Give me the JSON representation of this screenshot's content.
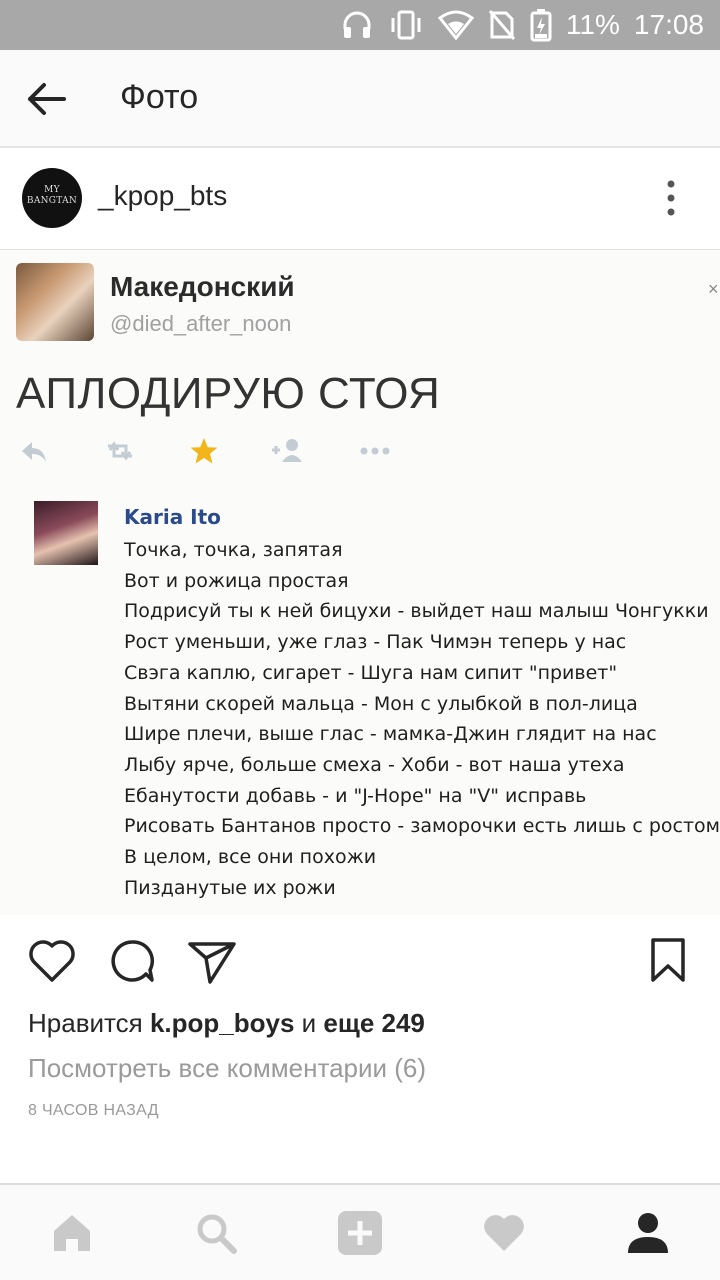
{
  "status_bar": {
    "battery": "11%",
    "time": "17:08",
    "icons": [
      "headphones-icon",
      "vibrate-icon",
      "wifi-icon",
      "no-sim-icon",
      "battery-icon"
    ]
  },
  "topbar": {
    "title": "Фото",
    "back_icon": "arrow-left-icon"
  },
  "post": {
    "username": "_kpop_bts",
    "avatar_text_line1": "MY",
    "avatar_text_line2": "BANGTAN",
    "more_icon": "more-vertical-icon"
  },
  "photo": {
    "tweet": {
      "name": "Македонский",
      "handle": "@died_after_noon",
      "close": "×",
      "text": "АПЛОДИРУЮ СТОЯ",
      "actions": [
        "reply-icon",
        "retweet-icon",
        "star-icon",
        "follow-icon",
        "more-horizontal-icon"
      ]
    },
    "inner_post": {
      "name": "Karia Ito",
      "lines": [
        "Точка, точка, запятая",
        "Вот и рожица простая",
        "Подрисуй ты к ней бицухи - выйдет наш малыш Чонгукки",
        "Рост уменьши, уже глаз - Пак Чимэн теперь у нас",
        "Свэга каплю, сигарет - Шуга нам сипит \"привет\"",
        "Вытяни скорей мальца - Мон с улыбкой в пол-лица",
        "Шире плечи, выше глас - мамка-Джин глядит на нас",
        "Лыбу ярче, больше смеха - Хоби - вот наша утеха",
        "Ебанутости добавь - и \"J-Hope\" на \"V\" исправь",
        "Рисовать Бантанов просто - заморочки есть лишь с ростом",
        "В целом, все они похожи",
        "Пизданутые их рожи"
      ]
    }
  },
  "actions": {
    "like_icon": "heart-icon",
    "comment_icon": "comment-icon",
    "share_icon": "send-icon",
    "save_icon": "bookmark-icon"
  },
  "likes": {
    "prefix": "Нравится ",
    "user": "k.pop_boys",
    "middle": " и ",
    "more": "еще 249"
  },
  "comments_link": "Посмотреть все комментарии (6)",
  "time_ago": "8 ЧАСОВ НАЗАД",
  "bottom_nav": [
    "home-icon",
    "search-icon",
    "add-icon",
    "activity-heart-icon",
    "profile-icon"
  ],
  "colors": {
    "status_bar": "#a8a8a8",
    "accent_star": "#f2b51a",
    "inner_name": "#2a4a8a"
  }
}
